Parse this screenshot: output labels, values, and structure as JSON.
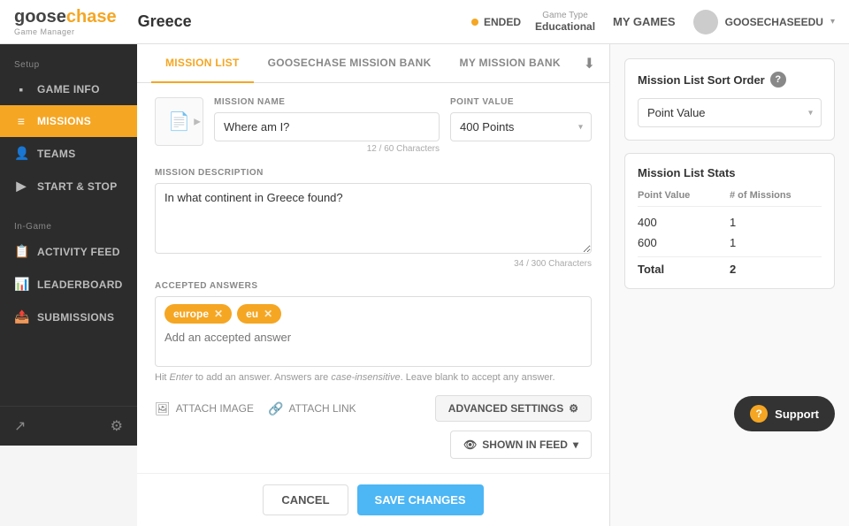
{
  "header": {
    "logo": "goosechase",
    "logo_sub": "Game Manager",
    "title": "Greece",
    "status_dot_color": "#f5a623",
    "status": "ENDED",
    "game_type_label": "Game Type",
    "game_type_value": "Educational",
    "my_games": "MY GAMES",
    "username": "GOOSECHASEEDU"
  },
  "sidebar": {
    "setup_label": "Setup",
    "ingame_label": "In-Game",
    "items": [
      {
        "id": "game-info",
        "label": "GAME INFO",
        "icon": "🎮"
      },
      {
        "id": "missions",
        "label": "MISSIONS",
        "icon": "📋",
        "active": true
      },
      {
        "id": "teams",
        "label": "TEAMS",
        "icon": "👥"
      },
      {
        "id": "start-stop",
        "label": "START & STOP",
        "icon": "▶"
      },
      {
        "id": "activity-feed",
        "label": "ACTIVITY FEED",
        "icon": "📊"
      },
      {
        "id": "leaderboard",
        "label": "LEADERBOARD",
        "icon": "🏆"
      },
      {
        "id": "submissions",
        "label": "SUBMISSIONS",
        "icon": "📤"
      }
    ]
  },
  "tabs": {
    "items": [
      {
        "id": "mission-list",
        "label": "MISSION LIST",
        "active": true
      },
      {
        "id": "goosechase-bank",
        "label": "GOOSECHASE MISSION BANK",
        "active": false
      },
      {
        "id": "my-bank",
        "label": "MY MISSION BANK",
        "active": false
      }
    ],
    "download_icon": "⬇"
  },
  "form": {
    "mission_name_label": "MISSION NAME",
    "mission_name_value": "Where am I?",
    "mission_name_chars": "12 / 60 Characters",
    "point_value_label": "POINT VALUE",
    "point_value": "400 Points",
    "mission_desc_label": "MISSION DESCRIPTION",
    "mission_desc_value": "In what continent in Greece found?",
    "mission_desc_chars": "34 / 300 Characters",
    "accepted_answers_label": "ACCEPTED ANSWERS",
    "answers": [
      {
        "text": "europe"
      },
      {
        "text": "eu"
      }
    ],
    "answer_placeholder": "Add an accepted answer",
    "answer_hint": "Hit Enter to add an answer. Answers are case-insensitive. Leave blank to accept any answer.",
    "attach_image_label": "ATTACH IMAGE",
    "attach_link_label": "ATTACH LINK",
    "advanced_settings_label": "ADVANCED SETTINGS",
    "shown_in_feed_label": "SHOWN IN FEED",
    "cancel_label": "CANCEL",
    "save_label": "SAVE CHANGES"
  },
  "right_panel": {
    "sort_title": "Mission List Sort Order",
    "sort_help_icon": "?",
    "sort_value": "Point Value",
    "stats_title": "Mission List Stats",
    "col_point_value": "Point Value",
    "col_missions": "# of Missions",
    "rows": [
      {
        "point_value": "400",
        "missions": "1"
      },
      {
        "point_value": "600",
        "missions": "1"
      }
    ],
    "total_label": "Total",
    "total_value": "2"
  },
  "support": {
    "label": "Support",
    "icon": "?"
  }
}
